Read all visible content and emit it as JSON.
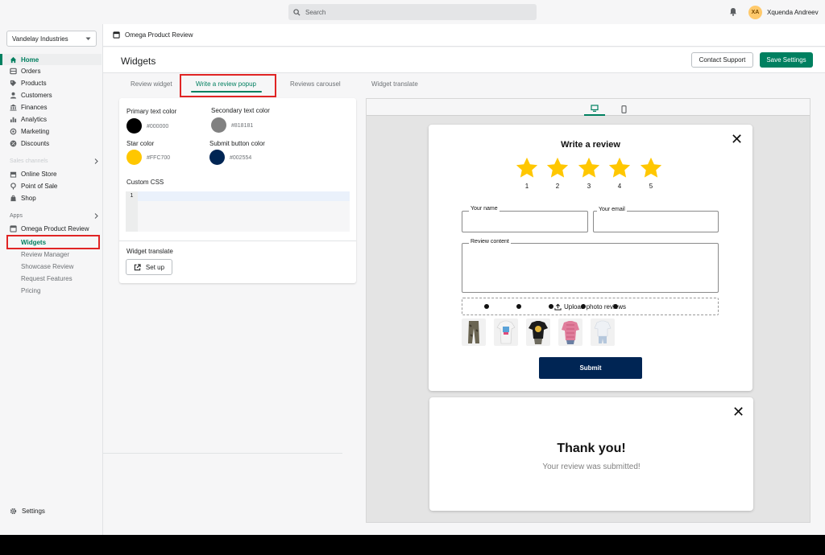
{
  "topbar": {
    "search_placeholder": "Search",
    "user_initials": "XA",
    "user_name": "Xquenda Andreev"
  },
  "sidebar": {
    "store_name": "Vandelay Industries",
    "main_items": [
      {
        "label": "Home",
        "icon": "home-icon",
        "active": true
      },
      {
        "label": "Orders",
        "icon": "orders-icon"
      },
      {
        "label": "Products",
        "icon": "tag-icon"
      },
      {
        "label": "Customers",
        "icon": "person-icon"
      },
      {
        "label": "Finances",
        "icon": "bank-icon"
      },
      {
        "label": "Analytics",
        "icon": "chart-icon"
      },
      {
        "label": "Marketing",
        "icon": "marketing-icon"
      },
      {
        "label": "Discounts",
        "icon": "discount-icon"
      }
    ],
    "sales_channels_label": "Sales channels",
    "channels": [
      {
        "label": "Online Store",
        "icon": "store-icon"
      },
      {
        "label": "Point of Sale",
        "icon": "pos-icon"
      },
      {
        "label": "Shop",
        "icon": "shop-icon"
      }
    ],
    "apps_label": "Apps",
    "app_name": "Omega Product Review",
    "app_sub_items": [
      {
        "label": "Widgets",
        "active": true
      },
      {
        "label": "Review Manager"
      },
      {
        "label": "Showcase Review"
      },
      {
        "label": "Request Features"
      },
      {
        "label": "Pricing"
      }
    ],
    "settings_label": "Settings"
  },
  "appbar": {
    "title": "Omega Product Review"
  },
  "page": {
    "title": "Widgets",
    "contact_label": "Contact Support",
    "save_label": "Save Settings"
  },
  "tabs": [
    {
      "label": "Review widget"
    },
    {
      "label": "Write a review popup",
      "active": true
    },
    {
      "label": "Reviews carousel"
    },
    {
      "label": "Widget translate"
    }
  ],
  "settings": {
    "primary": {
      "label": "Primary text color",
      "hex": "#000000"
    },
    "secondary": {
      "label": "Secondary text color",
      "hex": "#818181"
    },
    "star": {
      "label": "Star color",
      "hex": "#FFC700"
    },
    "submit": {
      "label": "Submit button color",
      "hex": "#002554"
    },
    "custom_css_label": "Custom CSS",
    "code_line_number": "1",
    "translate_label": "Widget translate",
    "setup_label": "Set up"
  },
  "colors": {
    "accent": "#008060",
    "primary_text": "#000000",
    "secondary_text": "#818181",
    "star": "#FFC700",
    "submit": "#002554"
  },
  "popup": {
    "title": "Write a review",
    "stars": [
      "1",
      "2",
      "3",
      "4",
      "5"
    ],
    "name_label": "Your name",
    "email_label": "Your email",
    "content_label": "Review content",
    "upload_label": "Upload photo reviews",
    "submit_label": "Submit"
  },
  "thankyou": {
    "title": "Thank you!",
    "subtitle": "Your review was submitted!"
  }
}
